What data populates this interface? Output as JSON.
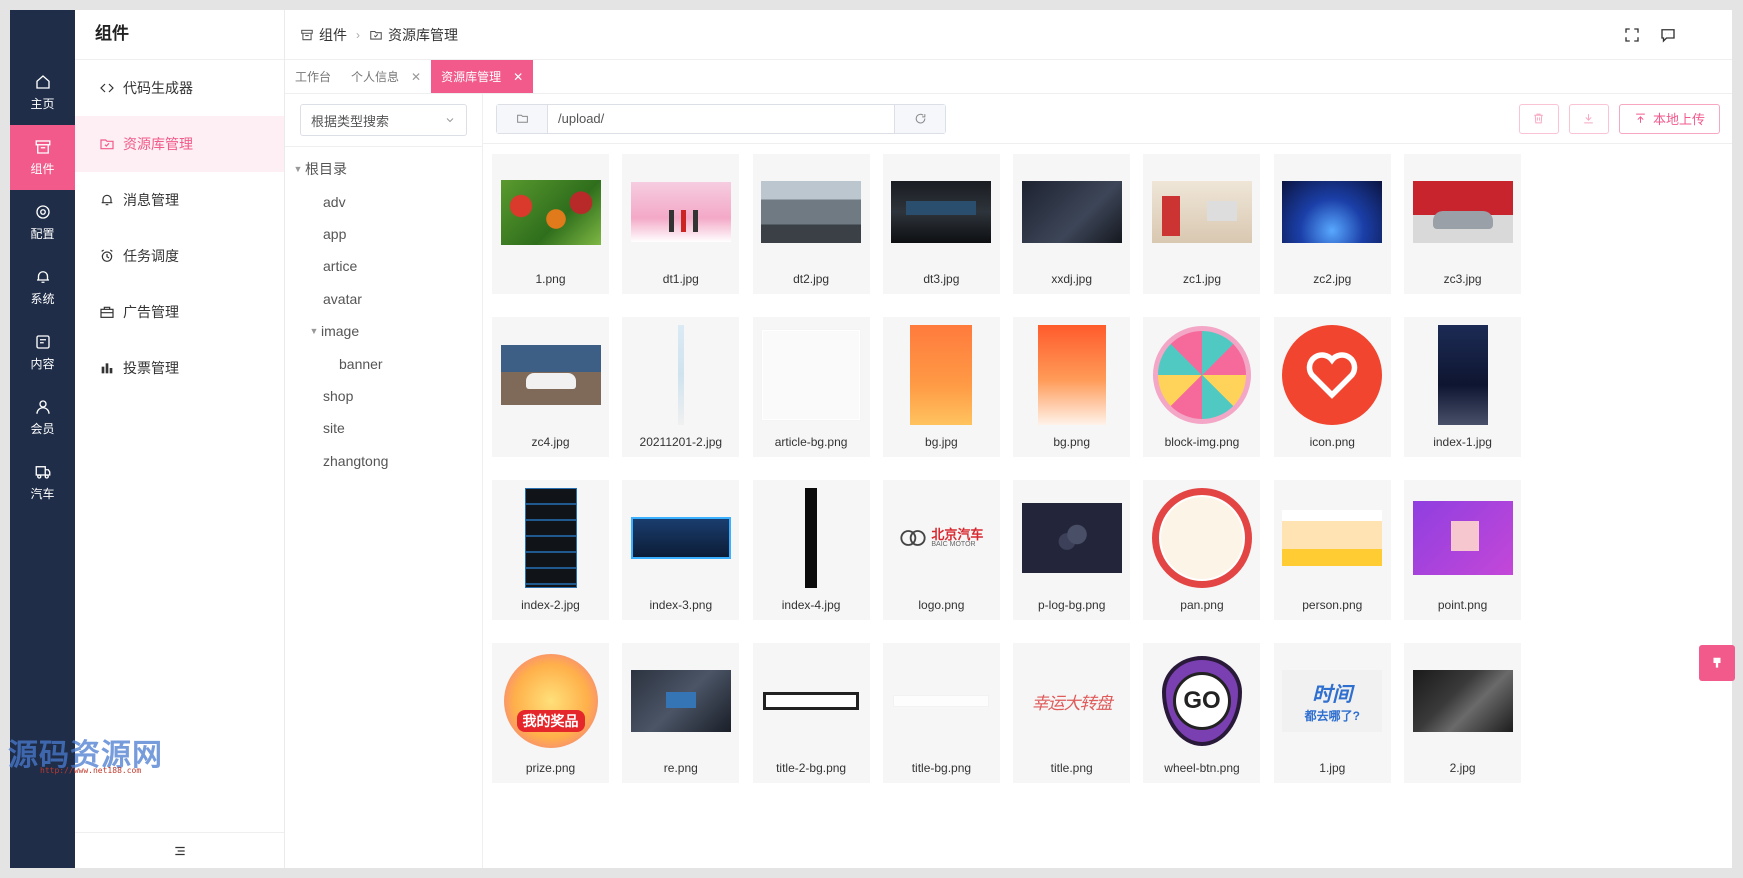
{
  "sidebar": {
    "items": [
      {
        "label": "主页",
        "icon": "home-icon",
        "active": false
      },
      {
        "label": "组件",
        "icon": "box-icon",
        "active": true
      },
      {
        "label": "配置",
        "icon": "gear-icon",
        "active": false
      },
      {
        "label": "系统",
        "icon": "bell-icon",
        "active": false
      },
      {
        "label": "内容",
        "icon": "document-icon",
        "active": false
      },
      {
        "label": "会员",
        "icon": "user-icon",
        "active": false
      },
      {
        "label": "汽车",
        "icon": "truck-icon",
        "active": false
      }
    ]
  },
  "submenu": {
    "title": "组件",
    "items": [
      {
        "label": "代码生成器",
        "icon": "code-icon"
      },
      {
        "label": "资源库管理",
        "icon": "folder-check-icon",
        "active": true
      },
      {
        "label": "消息管理",
        "icon": "bell-icon"
      },
      {
        "label": "任务调度",
        "icon": "alarm-clock-icon"
      },
      {
        "label": "广告管理",
        "icon": "briefcase-icon"
      },
      {
        "label": "投票管理",
        "icon": "bar-chart-icon"
      }
    ]
  },
  "header": {
    "breadcrumb": [
      "组件",
      "资源库管理"
    ]
  },
  "tabs": [
    {
      "label": "工作台",
      "closable": false
    },
    {
      "label": "个人信息",
      "closable": true
    },
    {
      "label": "资源库管理",
      "closable": true,
      "active": true
    }
  ],
  "tree": {
    "search_placeholder": "根据类型搜索",
    "nodes": [
      {
        "label": "根目录",
        "level": 0,
        "expanded": true
      },
      {
        "label": "adv",
        "level": 1
      },
      {
        "label": "app",
        "level": 1
      },
      {
        "label": "artice",
        "level": 1
      },
      {
        "label": "avatar",
        "level": 1
      },
      {
        "label": "image",
        "level": 1,
        "expanded": true
      },
      {
        "label": "banner",
        "level": 2
      },
      {
        "label": "shop",
        "level": 1
      },
      {
        "label": "site",
        "level": 1
      },
      {
        "label": "zhangtong",
        "level": 1
      }
    ]
  },
  "toolbar": {
    "path": "/upload/",
    "upload_label": "本地上传"
  },
  "files": [
    {
      "name": "1.png",
      "thumb": "vegetables"
    },
    {
      "name": "dt1.jpg",
      "thumb": "stage-pink"
    },
    {
      "name": "dt2.jpg",
      "thumb": "parking-lot"
    },
    {
      "name": "dt3.jpg",
      "thumb": "car-dashboard"
    },
    {
      "name": "xxdj.jpg",
      "thumb": "car-interior"
    },
    {
      "name": "zc1.jpg",
      "thumb": "office-people"
    },
    {
      "name": "zc2.jpg",
      "thumb": "blue-stage"
    },
    {
      "name": "zc3.jpg",
      "thumb": "red-car"
    },
    {
      "name": "zc4.jpg",
      "thumb": "white-suv"
    },
    {
      "name": "20211201-2.jpg",
      "thumb": "thin-strip"
    },
    {
      "name": "article-bg.png",
      "thumb": "blank-frame"
    },
    {
      "name": "bg.jpg",
      "thumb": "orange-poster"
    },
    {
      "name": "bg.png",
      "thumb": "orange-rays"
    },
    {
      "name": "block-img.png",
      "thumb": "prize-wheel"
    },
    {
      "name": "icon.png",
      "thumb": "heart-circle"
    },
    {
      "name": "index-1.jpg",
      "thumb": "dark-poster"
    },
    {
      "name": "index-2.jpg",
      "thumb": "tall-ui"
    },
    {
      "name": "index-3.png",
      "thumb": "blue-panel"
    },
    {
      "name": "index-4.jpg",
      "thumb": "black-strip"
    },
    {
      "name": "logo.png",
      "thumb": "baic-logo"
    },
    {
      "name": "p-log-bg.png",
      "thumb": "night-balloons"
    },
    {
      "name": "pan.png",
      "thumb": "ring-plate"
    },
    {
      "name": "person.png",
      "thumb": "people-group"
    },
    {
      "name": "point.png",
      "thumb": "gift-purple"
    },
    {
      "name": "prize.png",
      "thumb": "prize-gift"
    },
    {
      "name": "re.png",
      "thumb": "car-dashboard-2"
    },
    {
      "name": "title-2-bg.png",
      "thumb": "bar-frame"
    },
    {
      "name": "title-bg.png",
      "thumb": "faint-frame"
    },
    {
      "name": "title.png",
      "thumb": "red-calligraphy"
    },
    {
      "name": "wheel-btn.png",
      "thumb": "go-button"
    },
    {
      "name": "1.jpg",
      "thumb": "time-text"
    },
    {
      "name": "2.jpg",
      "thumb": "dark-brochure"
    }
  ],
  "thumb_texts": {
    "baic_logo_cn": "北京汽车",
    "baic_logo_en": "BAIC MOTOR",
    "prize_label": "我的奖品",
    "go_label": "GO",
    "time_text": "时间",
    "time_sub": "都去哪了?",
    "calligraphy": "幸运大转盘"
  },
  "watermark": {
    "text": "源码资源网",
    "url": "http://www.net188.com"
  },
  "colors": {
    "accent": "#f25a8b",
    "rail_bg": "#1f2d48"
  }
}
